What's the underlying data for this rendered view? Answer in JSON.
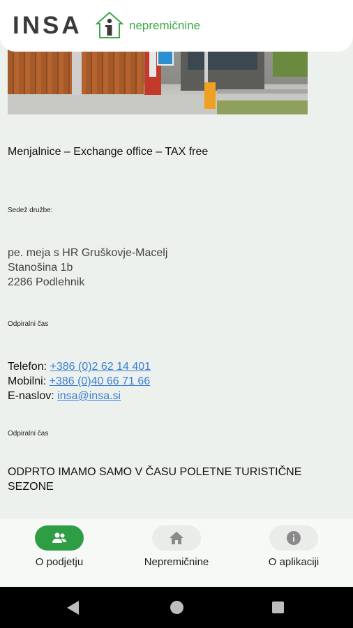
{
  "header": {
    "logo_text": "INSA",
    "logo_subtitle": "nepremičnine",
    "brand_green": "#3ea84a"
  },
  "content": {
    "heading": "Menjalnice – Exchange office – TAX free",
    "seat_label": "Sedež družbe:",
    "address": {
      "line1": "pe. meja s HR Gruškovje-Macelj",
      "line2": "Stanošina 1b",
      "line3": "2286 Podlehnik"
    },
    "hours_label_1": "Odpiralni čas",
    "contacts": {
      "phone_label": "Telefon:",
      "phone_value": "+386 (0)2 62 14 401",
      "mobile_label": "Mobilni:",
      "mobile_value": "+386 (0)40 66 71 66",
      "email_label": "E-naslov:",
      "email_value": "insa@insa.si"
    },
    "hours_label_2": "Odpiralni čas",
    "notice": "ODPRTO IMAMO SAMO V ČASU POLETNE TURISTIČNE SEZONE"
  },
  "bottom_nav": {
    "items": [
      {
        "label": "O podjetju",
        "icon": "people-icon",
        "active": true
      },
      {
        "label": "Nepremičnine",
        "icon": "home-icon",
        "active": false
      },
      {
        "label": "O aplikaciji",
        "icon": "info-icon",
        "active": false
      }
    ],
    "active_color": "#2e9e44"
  },
  "system_nav": {
    "back": "back-icon",
    "home": "home-circle-icon",
    "recents": "recents-icon"
  }
}
